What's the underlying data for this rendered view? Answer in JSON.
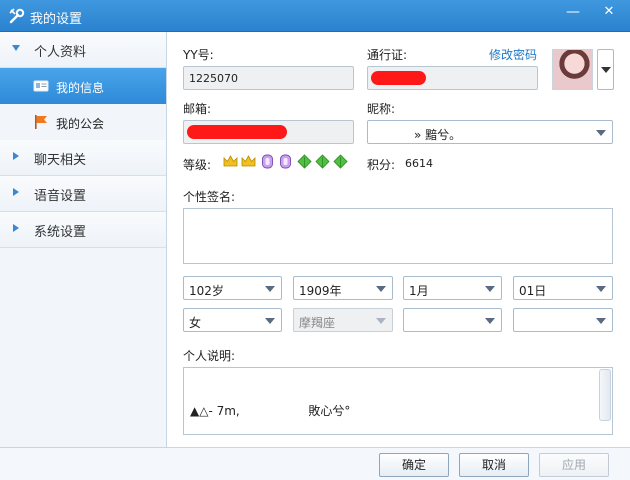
{
  "window": {
    "title": "我的设置",
    "minimize": "—",
    "close": "✕"
  },
  "sidebar": {
    "sections": [
      {
        "label": "个人资料",
        "expanded": true
      },
      {
        "label": "聊天相关",
        "expanded": false
      },
      {
        "label": "语音设置",
        "expanded": false
      },
      {
        "label": "系统设置",
        "expanded": false
      }
    ],
    "subitems": [
      {
        "label": "我的信息",
        "icon": "id-card-icon",
        "selected": true
      },
      {
        "label": "我的公会",
        "icon": "flag-icon",
        "selected": false
      }
    ]
  },
  "profile": {
    "yy_label": "YY号:",
    "yy_value": "1225070",
    "passport_label": "通行证:",
    "change_password": "修改密码",
    "email_label": "邮箱:",
    "nickname_label": "昵称:",
    "nickname_value": "»                    黯兮。",
    "level_label": "等级:",
    "score_label": "积分:",
    "score_value": "6614",
    "signature_label": "个性签名:",
    "signature_value": "",
    "age": "102岁",
    "year": "1909年",
    "month": "1月",
    "day": "01日",
    "gender": "女",
    "zodiac": "摩羯座",
    "province": "",
    "city": "",
    "description_label": "个人说明:",
    "description_value": "▲△- 7m,                  敗心兮°"
  },
  "colors": {
    "accent": "#2f8ad8",
    "titlebar": "#3f98df",
    "redaction": "#ff1818",
    "link": "#1e78c8"
  },
  "footer": {
    "ok": "确定",
    "cancel": "取消",
    "apply": "应用"
  }
}
